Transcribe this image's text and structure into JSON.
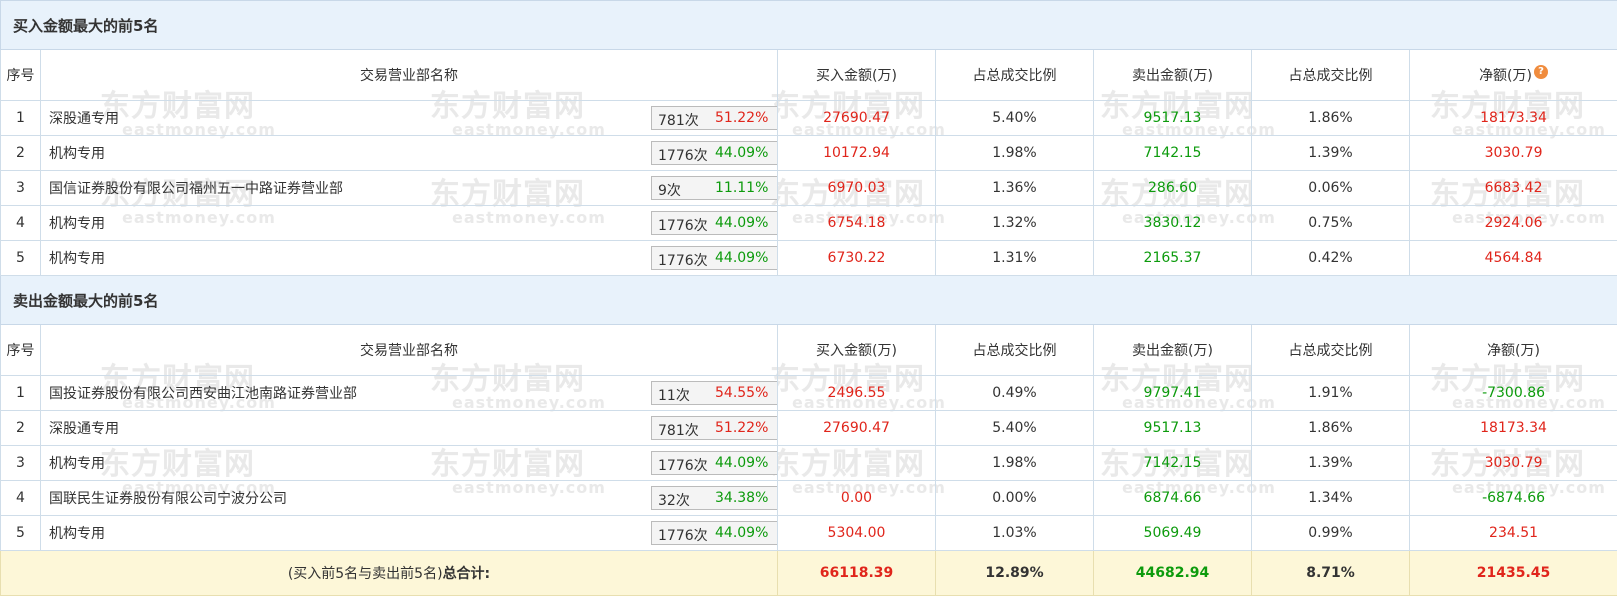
{
  "buy_section": {
    "title": "买入金额最大的前5名",
    "headers": [
      "序号",
      "交易营业部名称",
      "买入金额(万)",
      "占总成交比例",
      "卖出金额(万)",
      "占总成交比例",
      "净额(万)"
    ],
    "rows": [
      {
        "idx": "1",
        "name": "深股通专用",
        "count": "781次",
        "pct": "51.22%",
        "pct_color": "red",
        "action": "help",
        "buy": "27690.47",
        "buy_ratio": "5.40%",
        "sell": "9517.13",
        "sell_ratio": "1.86%",
        "net": "18173.34"
      },
      {
        "idx": "2",
        "name": "机构专用",
        "count": "1776次",
        "pct": "44.09%",
        "pct_color": "green",
        "action": "expand",
        "buy": "10172.94",
        "buy_ratio": "1.98%",
        "sell": "7142.15",
        "sell_ratio": "1.39%",
        "net": "3030.79"
      },
      {
        "idx": "3",
        "name": "国信证券股份有限公司福州五一中路证券营业部",
        "count": "9次",
        "pct": "11.11%",
        "pct_color": "green",
        "action": "expand",
        "buy": "6970.03",
        "buy_ratio": "1.36%",
        "sell": "286.60",
        "sell_ratio": "0.06%",
        "net": "6683.42"
      },
      {
        "idx": "4",
        "name": "机构专用",
        "count": "1776次",
        "pct": "44.09%",
        "pct_color": "green",
        "action": "expand",
        "buy": "6754.18",
        "buy_ratio": "1.32%",
        "sell": "3830.12",
        "sell_ratio": "0.75%",
        "net": "2924.06"
      },
      {
        "idx": "5",
        "name": "机构专用",
        "count": "1776次",
        "pct": "44.09%",
        "pct_color": "green",
        "action": "expand",
        "buy": "6730.22",
        "buy_ratio": "1.31%",
        "sell": "2165.37",
        "sell_ratio": "0.42%",
        "net": "4564.84"
      }
    ]
  },
  "sell_section": {
    "title": "卖出金额最大的前5名",
    "headers": [
      "序号",
      "交易营业部名称",
      "买入金额(万)",
      "占总成交比例",
      "卖出金额(万)",
      "占总成交比例",
      "净额(万)"
    ],
    "rows": [
      {
        "idx": "1",
        "name": "国投证券股份有限公司西安曲江池南路证券营业部",
        "count": "11次",
        "pct": "54.55%",
        "pct_color": "red",
        "action": "help",
        "buy": "2496.55",
        "buy_ratio": "0.49%",
        "sell": "9797.41",
        "sell_ratio": "1.91%",
        "net": "-7300.86"
      },
      {
        "idx": "2",
        "name": "深股通专用",
        "count": "781次",
        "pct": "51.22%",
        "pct_color": "red",
        "action": "expand",
        "buy": "27690.47",
        "buy_ratio": "5.40%",
        "sell": "9517.13",
        "sell_ratio": "1.86%",
        "net": "18173.34"
      },
      {
        "idx": "3",
        "name": "机构专用",
        "count": "1776次",
        "pct": "44.09%",
        "pct_color": "green",
        "action": "expand",
        "buy": "",
        "buy_ratio": "1.98%",
        "sell": "7142.15",
        "sell_ratio": "1.39%",
        "net": "3030.79"
      },
      {
        "idx": "4",
        "name": "国联民生证券股份有限公司宁波分公司",
        "count": "32次",
        "pct": "34.38%",
        "pct_color": "green",
        "action": "expand",
        "buy": "0.00",
        "buy_ratio": "0.00%",
        "sell": "6874.66",
        "sell_ratio": "1.34%",
        "net": "-6874.66"
      },
      {
        "idx": "5",
        "name": "机构专用",
        "count": "1776次",
        "pct": "44.09%",
        "pct_color": "green",
        "action": "expand",
        "buy": "5304.00",
        "buy_ratio": "1.03%",
        "sell": "5069.49",
        "sell_ratio": "0.99%",
        "net": "234.51"
      }
    ]
  },
  "total": {
    "label_prefix": "(买入前5名与卖出前5名)",
    "label_bold": "总合计:",
    "buy": "66118.39",
    "buy_ratio": "12.89%",
    "sell": "44682.94",
    "sell_ratio": "8.71%",
    "net": "21435.45"
  },
  "watermark": {
    "cn": "东方财富网",
    "en": "eastmoney.com"
  },
  "help_icon": {
    "glyph": "?",
    "icon": "question-circle-icon",
    "color": "#f08c3e"
  },
  "expand_icon": {
    "icon": "triangle-right-icon",
    "color": "#2b5d99"
  },
  "colors": {
    "section_bg": "#e8f2fb",
    "border": "#cfdde9",
    "total_bg": "#fdf7d8",
    "red": "#e0251b",
    "green": "#0d9b0d"
  }
}
